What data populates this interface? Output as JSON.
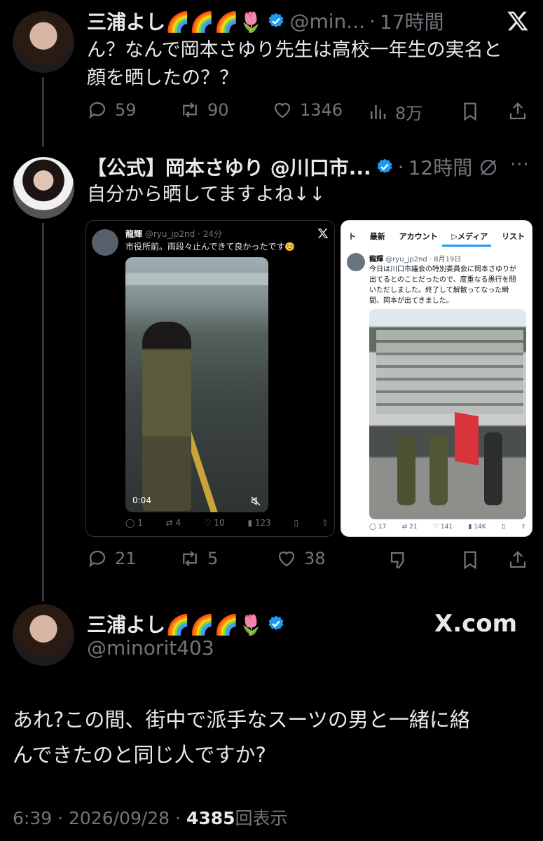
{
  "tweet1": {
    "name": "三浦よし🌈🌈🌈🌷",
    "handle": "@min...",
    "time": "17時間",
    "text_line1": "ん？なんで岡本さゆり先生は高校一年生の実名と",
    "text_line2": "顔を晒したの？？",
    "replies": "59",
    "retweets": "90",
    "likes": "1346",
    "views": "8万"
  },
  "tweet2": {
    "name": "【公式】岡本さゆり @川口市...",
    "time": "12時間",
    "text": "自分から晒してますよね↓↓",
    "replies": "21",
    "retweets": "5",
    "likes": "38"
  },
  "embed_left": {
    "name": "龍輝",
    "handle": "@ryu_jp2nd",
    "time": "24分",
    "text": "市役所前。雨段々止んできて良かったです☺️",
    "video_time": "0:04",
    "replies": "1",
    "retweets": "4",
    "likes": "10",
    "views": "123"
  },
  "embed_right": {
    "tabs": [
      "ト",
      "最新",
      "アカウント",
      "メディア",
      "リスト"
    ],
    "name": "龍輝",
    "handle": "@ryu_jp2nd",
    "time": "8月19日",
    "text_lines": [
      "今日は川口市議会の特別委員会に岡本さゆりが",
      "出てるとのことだったので、度重なる愚行を問",
      "いただしました。終了して解散ってなった瞬",
      "間、岡本が出てきました。"
    ],
    "replies": "17",
    "retweets": "21",
    "likes": "141",
    "views": "14K"
  },
  "tweet3": {
    "name": "三浦よし🌈🌈🌈🌷",
    "handle": "@minorit403",
    "brand": "X.com",
    "text_line1": "あれ?この間、街中で派手なスーツの男と一緒に絡",
    "text_line2": "んできたのと同じ人ですか?",
    "time": "6:39",
    "date": "2026/09/28",
    "views": "4385",
    "views_label": "回表示"
  },
  "colors": {
    "background": "#000000",
    "text": "#e7e9ea",
    "muted": "#71767b",
    "verified": "#1d9bf0",
    "divider": "#2f3336"
  }
}
